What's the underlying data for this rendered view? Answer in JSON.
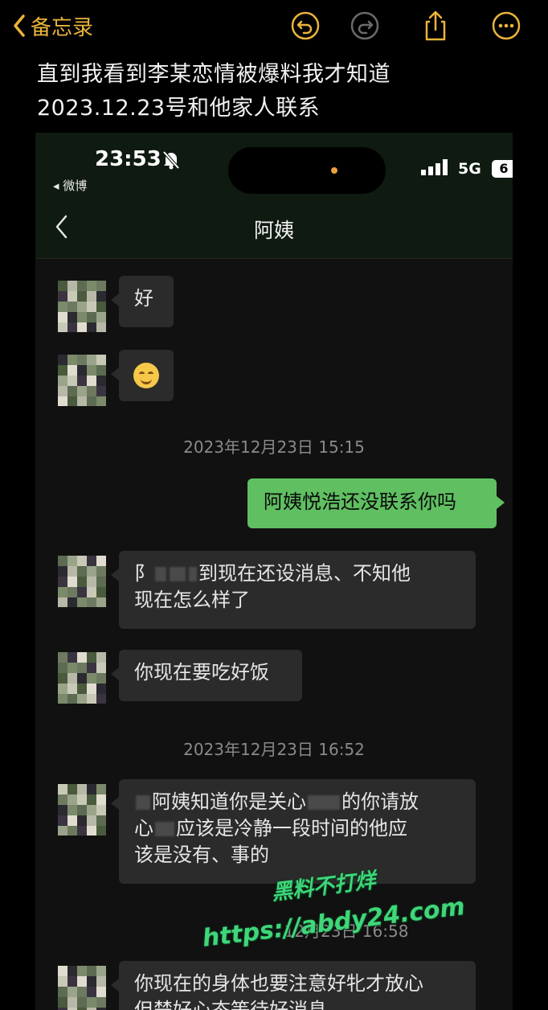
{
  "app_bar": {
    "back_label": "备忘录"
  },
  "note": {
    "line1": "直到我看到李某恋情被爆料我才知道",
    "line2": "2023.12.23号和他家人联系"
  },
  "screenshot": {
    "status_bar": {
      "time": "23:53",
      "back_app": "◂ 微博",
      "network": "5G",
      "battery": "6"
    },
    "chat_title": "阿姨",
    "messages": [
      {
        "type": "received",
        "text": "好"
      },
      {
        "type": "received",
        "emoji": "smiling-face-icon"
      },
      {
        "type": "timestamp",
        "text": "2023年12月23日 15:15"
      },
      {
        "type": "sent",
        "text": "阿姨悦浩还没联系你吗"
      },
      {
        "type": "received",
        "text_a": "阝",
        "text_b": "到现在还设消息、不知他",
        "text_c": "现在怎么样了"
      },
      {
        "type": "received",
        "text": "你现在要吃好饭"
      },
      {
        "type": "timestamp",
        "text": "2023年12月23日 16:52"
      },
      {
        "type": "received",
        "text_a": "阿姨知道你是关心",
        "text_b": "的你请放",
        "text_c": "心",
        "text_d": "应该是冷静一段时间的他应",
        "text_e": "该是没有、事的"
      },
      {
        "type": "timestamp",
        "text": "12月23日 16:58"
      },
      {
        "type": "received",
        "text_a": "你现在的身体也要注意好牝才放心",
        "text_b": "但楚好心态等待好消息"
      }
    ]
  },
  "watermark": {
    "line1": "黑料不打烊",
    "line2": "https://abdy24.com"
  },
  "colors": {
    "accent": "#e9b43a",
    "sent_bubble": "#5fbf61",
    "received_bubble": "#2b2b2b",
    "watermark": "#3fd67a"
  }
}
